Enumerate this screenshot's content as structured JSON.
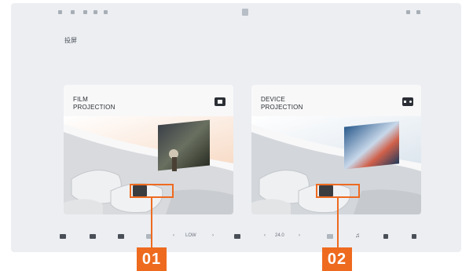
{
  "screen": {
    "title": "投屏"
  },
  "status_bar": {
    "left_items": [
      "",
      "",
      "",
      "",
      ""
    ],
    "right_items": [
      "",
      "",
      ""
    ]
  },
  "cards": [
    {
      "title": "FILM\nPROJECTION",
      "icon": "film-icon",
      "button_label": "",
      "callout": "01"
    },
    {
      "title": "DEVICE\nPROJECTION",
      "icon": "gamepad-icon",
      "button_label": "",
      "callout": "02"
    }
  ],
  "dock": {
    "fan_level": "LOW",
    "temperature": "24.0"
  },
  "colors": {
    "accent": "#ee6a1f",
    "screen_bg": "#eceef2",
    "card_bg": "#f8f8f9"
  }
}
